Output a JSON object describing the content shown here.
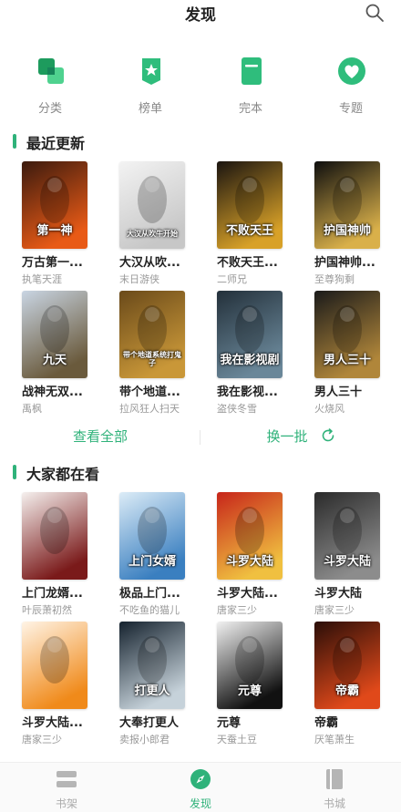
{
  "header": {
    "title": "发现"
  },
  "categories": [
    {
      "label": "分类",
      "icon": "category-icon"
    },
    {
      "label": "榜单",
      "icon": "ranking-icon"
    },
    {
      "label": "完本",
      "icon": "completed-book-icon"
    },
    {
      "label": "专题",
      "icon": "topic-heart-icon"
    }
  ],
  "recent": {
    "title": "最近更新",
    "books": [
      {
        "title": "万古第一...",
        "author": "执笔天涯",
        "cover_text": "第一神",
        "palette": [
          "#3b1a0e",
          "#e85a16"
        ]
      },
      {
        "title": "大汉从吹...",
        "author": "末日游侠",
        "cover_text": "大汉从吹牛开始",
        "palette": [
          "#f3f3f3",
          "#c7c7c7"
        ]
      },
      {
        "title": "不败天王...",
        "author": "二师兄",
        "cover_text": "不败天王",
        "palette": [
          "#1a1410",
          "#d8a128"
        ]
      },
      {
        "title": "护国神帅...",
        "author": "至尊狗剩",
        "cover_text": "护国神帅",
        "palette": [
          "#0e0e0e",
          "#d9b04a"
        ]
      },
      {
        "title": "战神无双...",
        "author": "禹枫",
        "cover_text": "九天",
        "palette": [
          "#c9d5e3",
          "#6a5a3c"
        ]
      },
      {
        "title": "带个地道...",
        "author": "拉风狂人扫天",
        "cover_text": "带个地道系统打鬼子",
        "palette": [
          "#6a4a1a",
          "#c99738"
        ]
      },
      {
        "title": "我在影视...",
        "author": "盗侠冬雪",
        "cover_text": "我在影视剧",
        "palette": [
          "#23303a",
          "#6a8799"
        ]
      },
      {
        "title": "男人三十",
        "author": "火烧风",
        "cover_text": "男人三十",
        "palette": [
          "#1a1a1a",
          "#b0863a"
        ]
      }
    ]
  },
  "actions": {
    "view_all": "查看全部",
    "refresh": "换一批"
  },
  "popular": {
    "title": "大家都在看",
    "books": [
      {
        "title": "上门龙婿...",
        "author": "叶辰萧初然",
        "cover_text": "",
        "palette": [
          "#f5f0ee",
          "#7a1a1a"
        ]
      },
      {
        "title": "极品上门...",
        "author": "不吃鱼的猫儿",
        "cover_text": "上门女婿",
        "palette": [
          "#dcecf7",
          "#3a7fc0"
        ]
      },
      {
        "title": "斗罗大陆...",
        "author": "唐家三少",
        "cover_text": "斗罗大陆",
        "palette": [
          "#c7251a",
          "#f0c040"
        ]
      },
      {
        "title": "斗罗大陆",
        "author": "唐家三少",
        "cover_text": "斗罗大陆",
        "palette": [
          "#2a2a2a",
          "#8c8c8c"
        ]
      },
      {
        "title": "斗罗大陆...",
        "author": "唐家三少",
        "cover_text": "",
        "palette": [
          "#fff4e6",
          "#f08a1a"
        ]
      },
      {
        "title": "大奉打更人",
        "author": "卖报小郎君",
        "cover_text": "打更人",
        "palette": [
          "#15222e",
          "#c6d2da"
        ]
      },
      {
        "title": "元尊",
        "author": "天蚕土豆",
        "cover_text": "元尊",
        "palette": [
          "#f2f2f2",
          "#111111"
        ]
      },
      {
        "title": "帝霸",
        "author": "厌笔萧生",
        "cover_text": "帝霸",
        "palette": [
          "#2a0e08",
          "#e0491a"
        ]
      }
    ]
  },
  "bottom_nav": [
    {
      "label": "书架",
      "icon": "bookshelf-icon",
      "active": false
    },
    {
      "label": "发现",
      "icon": "compass-icon",
      "active": true
    },
    {
      "label": "书城",
      "icon": "bookstore-icon",
      "active": false
    }
  ],
  "colors": {
    "accent": "#2fb27a",
    "muted": "#999999"
  }
}
